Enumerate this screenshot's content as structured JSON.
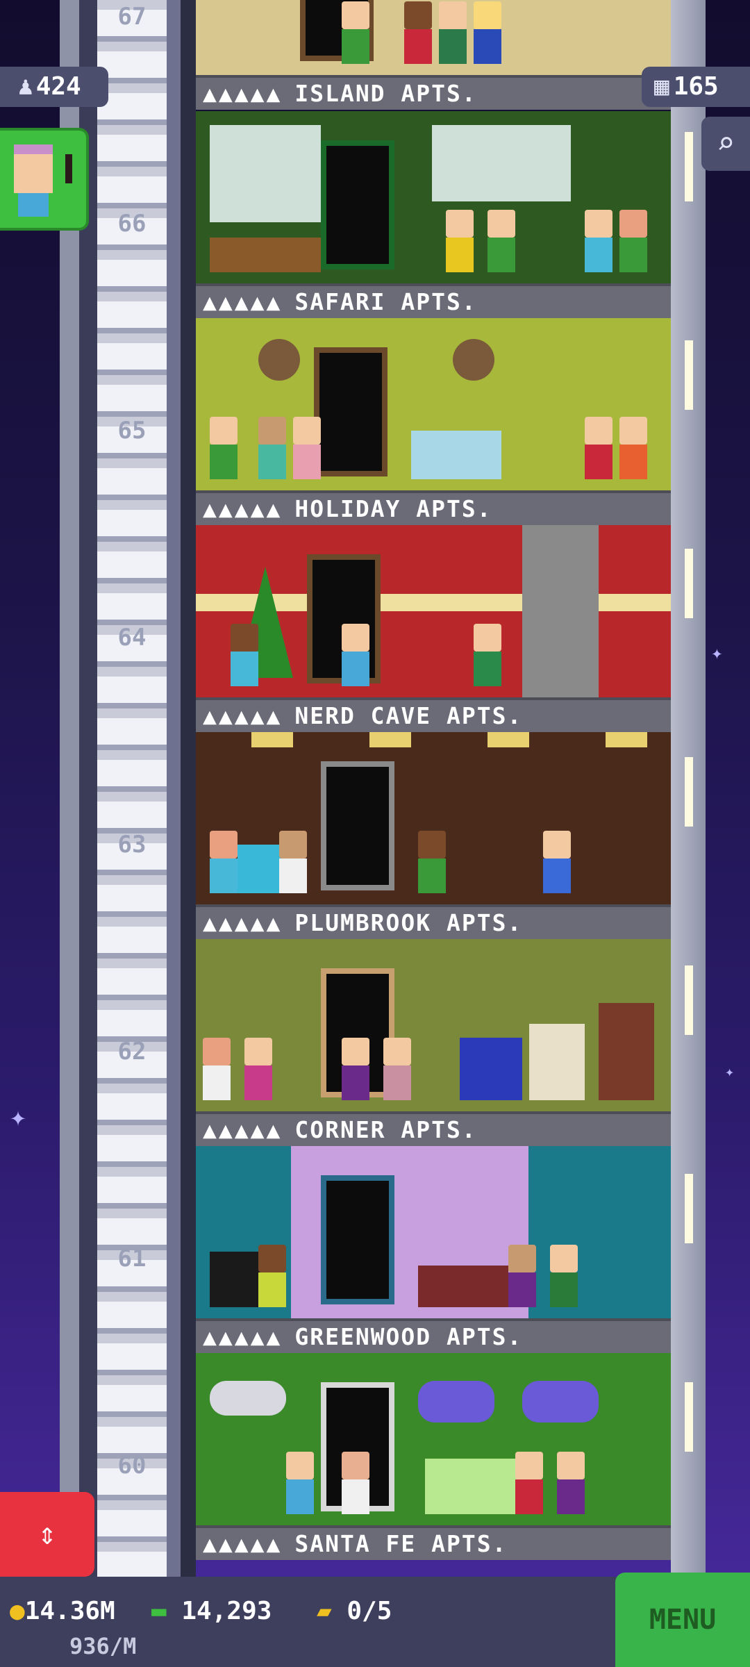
{
  "hud": {
    "population": "424",
    "floor_count": "165",
    "coins": "14.36M",
    "coin_rate": "936/M",
    "bux": "14,293",
    "tickets": "0/5",
    "menu_label": "MENU"
  },
  "colors": {
    "sky_top": "#120d2e",
    "sky_bottom": "#4a2aa0",
    "sign_bg": "#6b6b78",
    "menu_green": "#38b44a",
    "elevator_red": "#e8323f"
  },
  "floors": [
    {
      "number": "67",
      "name": "ISLAND APTS.",
      "stars": "▲▲▲▲▲",
      "wall": "#5a4a2a"
    },
    {
      "number": "66",
      "name": "SAFARI APTS.",
      "stars": "▲▲▲▲▲",
      "wall": "#3a5a2a"
    },
    {
      "number": "65",
      "name": "HOLIDAY APTS.",
      "stars": "▲▲▲▲▲",
      "wall": "#a8b83a"
    },
    {
      "number": "64",
      "name": "NERD CAVE APTS.",
      "stars": "▲▲▲▲▲",
      "wall": "#b8282a"
    },
    {
      "number": "63",
      "name": "PLUMBROOK APTS.",
      "stars": "▲▲▲▲▲",
      "wall": "#4a2a1a"
    },
    {
      "number": "62",
      "name": "CORNER APTS.",
      "stars": "▲▲▲▲▲",
      "wall": "#7a8a3a"
    },
    {
      "number": "61",
      "name": "GREENWOOD APTS.",
      "stars": "▲▲▲▲▲",
      "wall": "#1a7a8a"
    },
    {
      "number": "60",
      "name": "SANTA FE APTS.",
      "stars": "▲▲▲▲▲",
      "wall": "#3a8a2a"
    }
  ]
}
